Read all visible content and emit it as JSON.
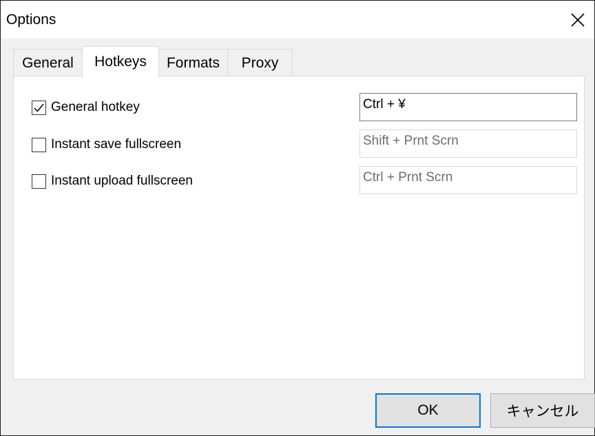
{
  "window": {
    "title": "Options"
  },
  "tabs": [
    {
      "label": "General",
      "selected": false
    },
    {
      "label": "Hotkeys",
      "selected": true
    },
    {
      "label": "Formats",
      "selected": false
    },
    {
      "label": "Proxy",
      "selected": false
    }
  ],
  "hotkeys": [
    {
      "label": "General hotkey",
      "checked": true,
      "value": "Ctrl + ¥",
      "enabled": true
    },
    {
      "label": "Instant save fullscreen",
      "checked": false,
      "value": "Shift + Prnt Scrn",
      "enabled": false
    },
    {
      "label": "Instant upload fullscreen",
      "checked": false,
      "value": "Ctrl + Prnt Scrn",
      "enabled": false
    }
  ],
  "buttons": {
    "ok_label": "OK",
    "cancel_label": "キャンセル"
  },
  "colors": {
    "focus_border": "#0078d7",
    "disabled_text": "#6d6d6d"
  }
}
